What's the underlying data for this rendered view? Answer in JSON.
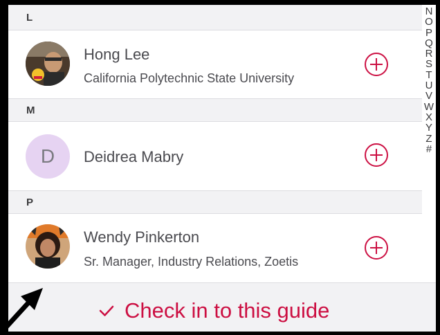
{
  "sections": [
    {
      "letter": "L"
    },
    {
      "letter": "M"
    },
    {
      "letter": "P"
    }
  ],
  "contacts": [
    {
      "name": "Hong Lee",
      "subtitle": "California Polytechnic State University",
      "avatar": "photo"
    },
    {
      "name": "Deidrea Mabry",
      "subtitle": "",
      "avatar_initial": "D"
    },
    {
      "name": "Wendy Pinkerton",
      "subtitle": "Sr. Manager, Industry Relations, Zoetis",
      "avatar": "photo"
    }
  ],
  "index": [
    "N",
    "O",
    "P",
    "Q",
    "R",
    "S",
    "T",
    "U",
    "V",
    "W",
    "X",
    "Y",
    "Z",
    "#"
  ],
  "footer": {
    "checkin_label": "Check in to this guide"
  },
  "colors": {
    "accent": "#cc0f42",
    "header_bg": "#f2f2f4",
    "initial_avatar_bg": "#e6d3f2"
  }
}
